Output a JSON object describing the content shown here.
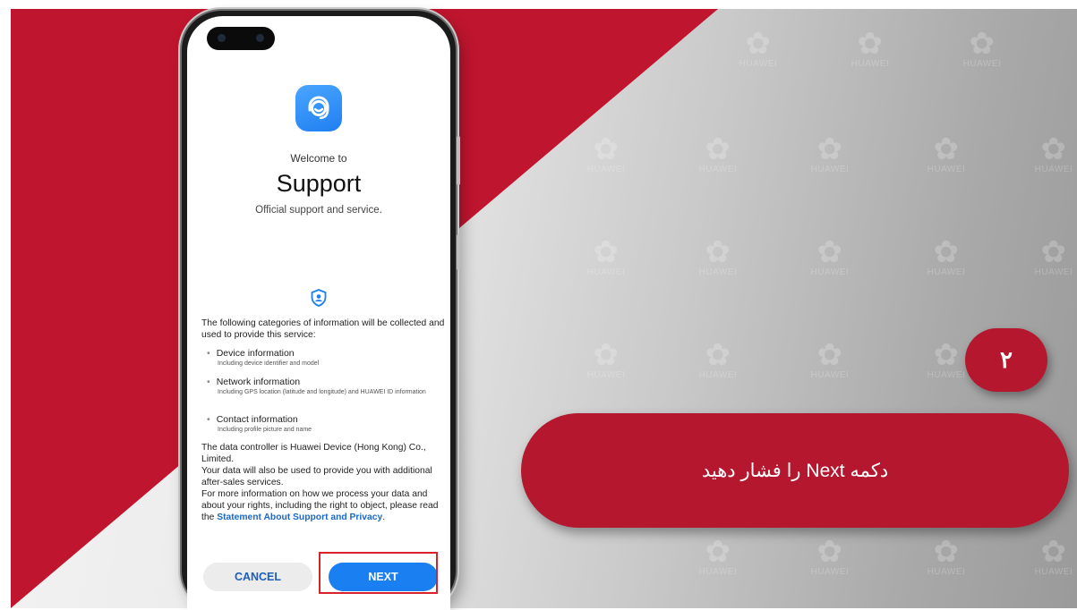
{
  "colors": {
    "brand_red": "#c0152f",
    "accent_blue": "#1a7ff0",
    "highlight_red": "#d8232a"
  },
  "watermark": {
    "brand": "HUAWEI",
    "icon": "huawei-flower-icon"
  },
  "phone": {
    "app_icon": "support-headset-icon",
    "welcome": "Welcome to",
    "title": "Support",
    "subtitle": "Official support and service.",
    "privacy_icon": "shield-user-icon",
    "intro": "The following categories of information will be collected and used to provide this service:",
    "categories": [
      {
        "title": "Device information",
        "detail": "Including device identifier and model"
      },
      {
        "title": "Network information",
        "detail": "Including GPS location (latitude and longitude) and HUAWEI ID information"
      },
      {
        "title": "Contact information",
        "detail": "Including profile picture and name"
      }
    ],
    "controller": "The data controller is Huawei Device (Hong Kong) Co., Limited.",
    "after_sales": "Your data will also be used to provide you with additional after-sales services.",
    "more_info": "For more information on how we process your data and about your rights, including the right to object, please read the",
    "statement_link": "Statement About Support and Privacy",
    "period": ".",
    "cancel_label": "CANCEL",
    "next_label": "NEXT"
  },
  "step": {
    "number": "۲",
    "instruction": "دکمه Next را فشار دهید"
  }
}
